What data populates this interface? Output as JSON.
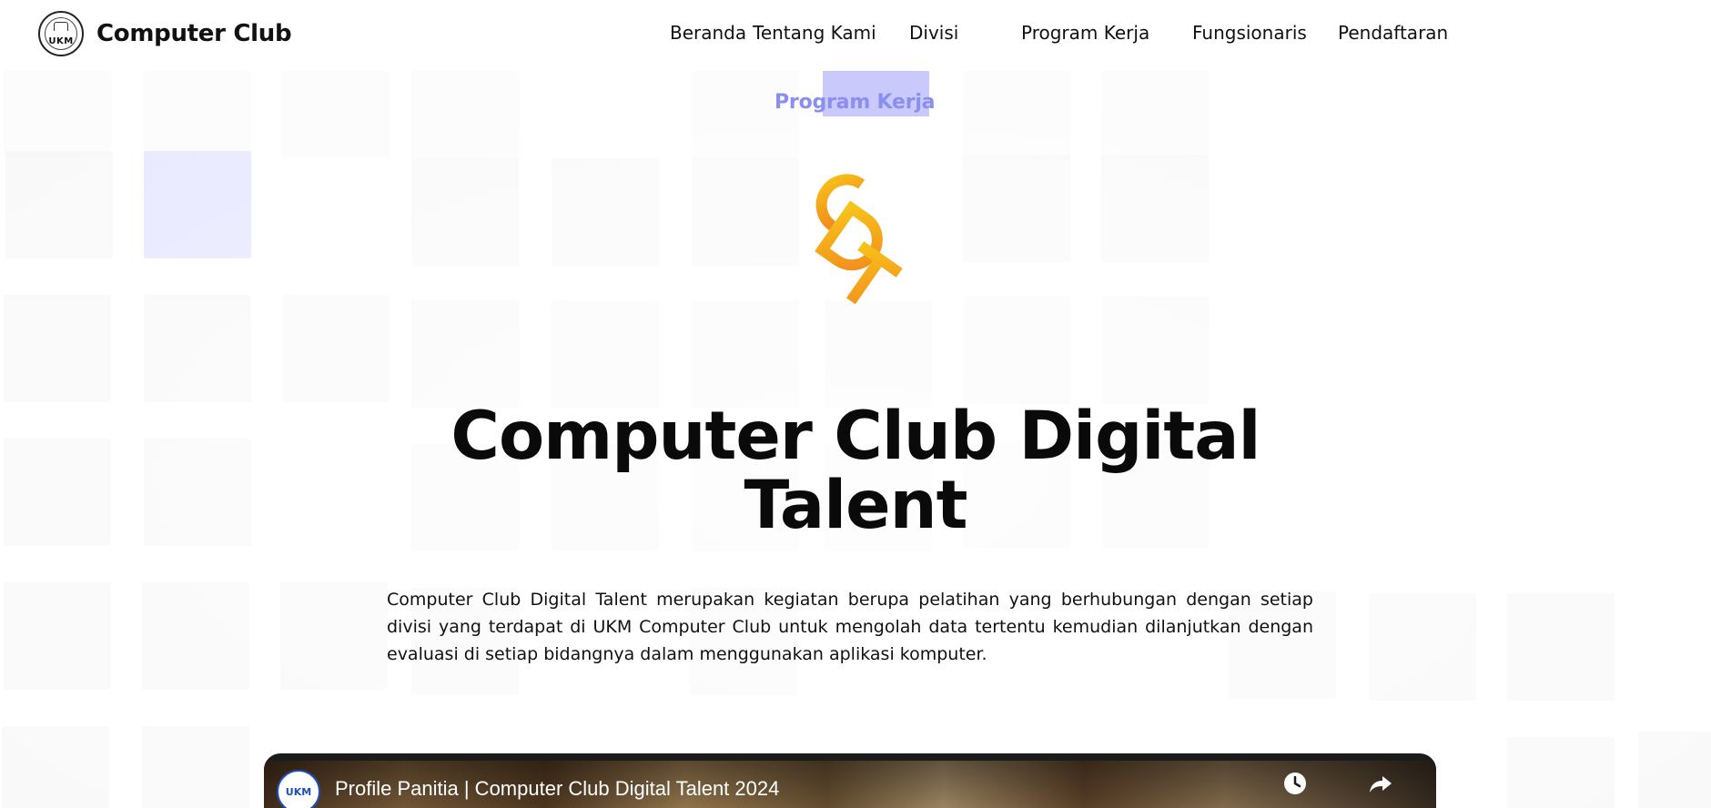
{
  "brand": {
    "name": "Computer Club",
    "logo_text": "UKM"
  },
  "nav": {
    "items": [
      {
        "label": "Beranda"
      },
      {
        "label": "Tentang Kami"
      },
      {
        "label": "Divisi"
      },
      {
        "label": "Program Kerja"
      },
      {
        "label": "Fungsionaris"
      },
      {
        "label": "Pendaftaran"
      }
    ]
  },
  "hero": {
    "eyebrow": "Program Kerja",
    "logo_letters": "CDT",
    "title_line1": "Computer Club Digital",
    "title_line2": "Talent",
    "description": "Computer Club Digital Talent merupakan kegiatan berupa pelatihan yang berhubungan dengan setiap divisi yang terdapat di UKM Computer Club untuk mengolah data tertentu kemudian dilanjutkan dengan evaluasi di setiap bidangnya dalam menggunakan aplikasi komputer."
  },
  "video": {
    "channel_logo_text": "UKM",
    "title": "Profile Panitia | Computer Club Digital Talent 2024",
    "controls": [
      {
        "icon": "clock-icon",
        "label": ""
      },
      {
        "icon": "share-icon",
        "label": ""
      }
    ]
  },
  "colors": {
    "accent": "#8a8ef0",
    "highlight": "#c9c9fb",
    "logo_gradient_start": "#f7c21a",
    "logo_gradient_end": "#f28b1c"
  }
}
